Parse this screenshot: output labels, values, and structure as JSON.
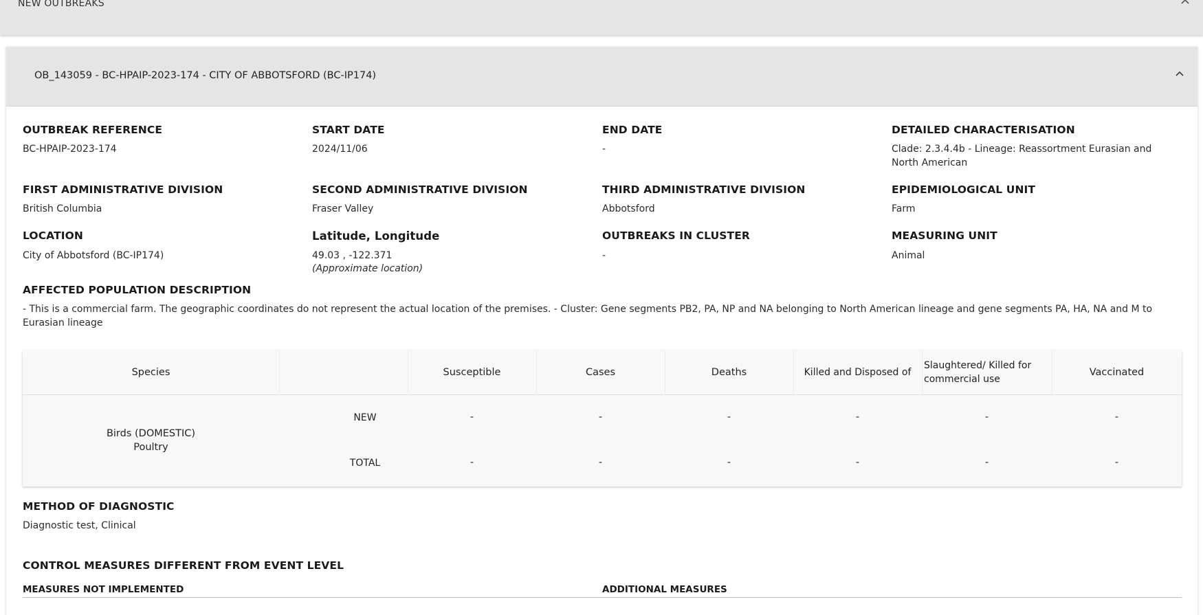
{
  "outer": {
    "title": "NEW OUTBREAKS"
  },
  "outbreak": {
    "header": "OB_143059 - BC-HPAIP-2023-174 - CITY OF ABBOTSFORD (BC-IP174)",
    "fields": {
      "outbreak_reference": {
        "label": "OUTBREAK REFERENCE",
        "value": "BC-HPAIP-2023-174"
      },
      "start_date": {
        "label": "START DATE",
        "value": "2024/11/06"
      },
      "end_date": {
        "label": "END DATE",
        "value": "-"
      },
      "detailed_characterisation": {
        "label": "DETAILED CHARACTERISATION",
        "value": "Clade: 2.3.4.4b - Lineage: Reassortment Eurasian and North American"
      },
      "first_admin": {
        "label": "FIRST ADMINISTRATIVE DIVISION",
        "value": "British Columbia"
      },
      "second_admin": {
        "label": "SECOND ADMINISTRATIVE DIVISION",
        "value": "Fraser Valley"
      },
      "third_admin": {
        "label": "THIRD ADMINISTRATIVE DIVISION",
        "value": "Abbotsford"
      },
      "epi_unit": {
        "label": "EPIDEMIOLOGICAL UNIT",
        "value": "Farm"
      },
      "location": {
        "label": "LOCATION",
        "value": "City of Abbotsford (BC-IP174)"
      },
      "lat_long": {
        "label": "Latitude, Longitude",
        "value": "49.03 , -122.371",
        "note": "(Approximate location)"
      },
      "outbreaks_in_cluster": {
        "label": "OUTBREAKS IN CLUSTER",
        "value": "-"
      },
      "measuring_unit": {
        "label": "MEASURING UNIT",
        "value": "Animal"
      },
      "affected_population": {
        "label": "AFFECTED POPULATION DESCRIPTION",
        "value": "- This is a commercial farm. The geographic coordinates do not represent the actual location of the premises. - Cluster: Gene segments PB2, PA, NP and NA belonging to North American lineage and gene segments PA, HA, NA and M to Eurasian lineage"
      }
    },
    "table": {
      "headers": {
        "species": "Species",
        "susceptible": "Susceptible",
        "cases": "Cases",
        "deaths": "Deaths",
        "killed": "Killed and Disposed of",
        "slaughtered": "Slaughtered/ Killed for commercial use",
        "vaccinated": "Vaccinated"
      },
      "species_name": "Birds (DOMESTIC)",
      "species_sub": "Poultry",
      "rows": [
        {
          "label": "NEW",
          "values": [
            "-",
            "-",
            "-",
            "-",
            "-",
            "-"
          ]
        },
        {
          "label": "TOTAL",
          "values": [
            "-",
            "-",
            "-",
            "-",
            "-",
            "-"
          ]
        }
      ]
    },
    "diagnostic": {
      "label": "METHOD OF DIAGNOSTIC",
      "value": "Diagnostic test, Clinical"
    },
    "control_measures": {
      "label": "CONTROL MEASURES DIFFERENT FROM EVENT LEVEL",
      "not_implemented": "MEASURES NOT IMPLEMENTED",
      "additional": "ADDITIONAL MEASURES"
    }
  }
}
